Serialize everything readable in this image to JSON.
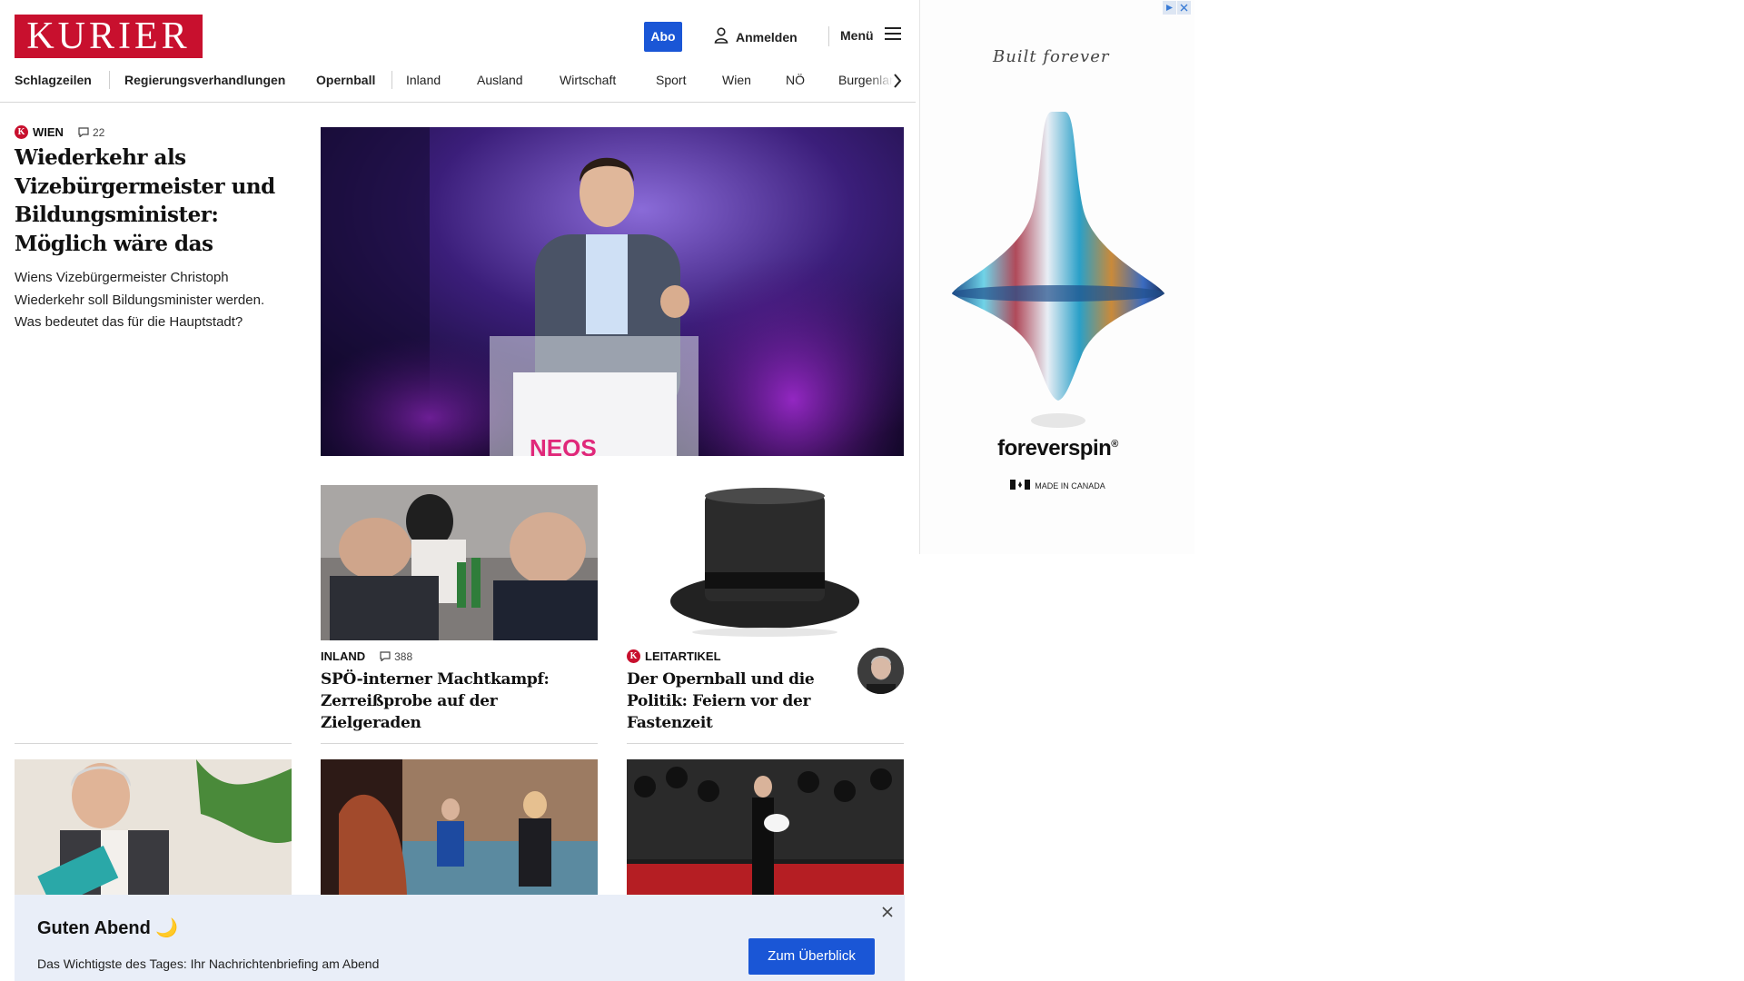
{
  "header": {
    "logo": "KURIER",
    "abo_label": "Abo",
    "login_label": "Anmelden",
    "menu_label": "Menü"
  },
  "nav": {
    "items": [
      "Schlagzeilen",
      "Regierungsverhandlungen",
      "Opernball",
      "Inland",
      "Ausland",
      "Wirtschaft",
      "Sport",
      "Wien",
      "NÖ",
      "Burgenland"
    ]
  },
  "lead": {
    "category": "WIEN",
    "comments": "22",
    "headline": "Wiederkehr als Vizebürgermeister und Bildungsminister: Möglich wäre das",
    "teaser": "Wiens Vizebürgermeister Christoph Wiederkehr soll Bildungsminister werden. Was bedeutet das für die Hauptstadt?",
    "image_text": "NEOS"
  },
  "cards": [
    {
      "category": "INLAND",
      "comments": "388",
      "headline": "SPÖ-interner Machtkampf: Zerreißprobe auf der Zielgeraden"
    },
    {
      "category": "LEITARTIKEL",
      "headline": "Der Opernball und die Politik: Feiern vor der Fastenzeit"
    }
  ],
  "banner": {
    "title": "Guten Abend 🌙",
    "text": "Das Wichtigste des Tages: Ihr Nachrichtenbriefing am Abend",
    "button": "Zum Überblick"
  },
  "ad": {
    "tagline": "Built forever",
    "brand": "foreverspin",
    "registered": "®",
    "made_in": "MADE IN CANADA"
  },
  "colors": {
    "brand_red": "#c8102e",
    "accent_blue": "#1a56d6",
    "banner_bg": "#e9eef8"
  },
  "icons": [
    "user-icon",
    "hamburger-icon",
    "chevron-right-icon",
    "comment-icon",
    "close-icon",
    "kurier-k-icon"
  ]
}
